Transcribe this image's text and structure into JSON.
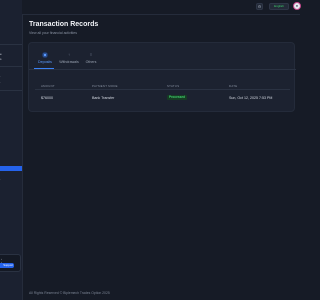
{
  "header": {
    "title": "Transaction Records",
    "subtitle": "View all your financial activities",
    "language_label": "English",
    "settings_icon": "gear-icon",
    "notifications_icon": "bell-icon"
  },
  "tabs": [
    {
      "label": "Deposits",
      "icon": "wallet-icon",
      "active": true
    },
    {
      "label": "Withdrawals",
      "icon": "arrow-up-icon",
      "active": false
    },
    {
      "label": "Others",
      "icon": "list-icon",
      "active": false
    }
  ],
  "table": {
    "columns": [
      "AMOUNT",
      "PAYMENT MODE",
      "STATUS",
      "DATE"
    ],
    "rows": [
      {
        "amount": "$76000",
        "payment_mode": "Bank Transfer",
        "status": "Processed",
        "date": "Sun, Oct 12, 2025 7:53 PM"
      }
    ]
  },
  "sidebar": {
    "support_label": "Support"
  },
  "footer": {
    "text": "All Rights Reserved © Biplemech Trades Option 2025"
  },
  "colors": {
    "background": "#161b26",
    "panel": "#1c2230",
    "accent": "#2563eb",
    "status_success": "#3ecf6b"
  }
}
